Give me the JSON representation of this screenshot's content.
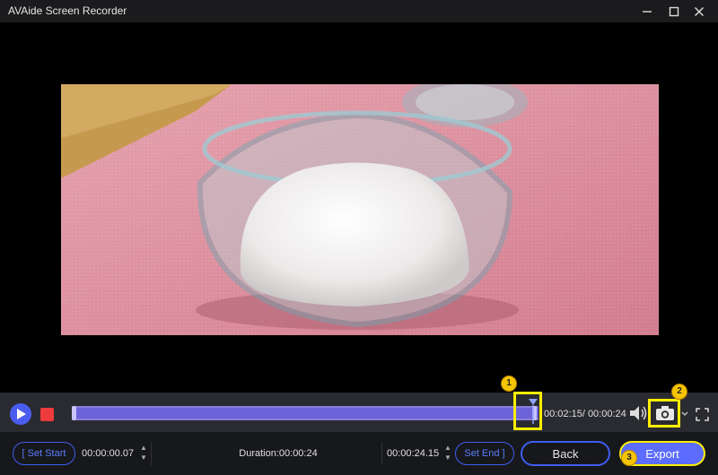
{
  "window": {
    "title": "AVAide Screen Recorder"
  },
  "playback": {
    "current_time": "00:02:15",
    "total_time": "/ 00:00:24"
  },
  "callouts": {
    "one": "1",
    "two": "2",
    "three": "3"
  },
  "trim": {
    "set_start_label": "Set Start",
    "start_time": "00:00:00.07",
    "duration_label": "Duration:00:00:24",
    "end_time": "00:00:24.15",
    "set_end_label": "Set End"
  },
  "buttons": {
    "back_label": "Back",
    "export_label": "Export"
  },
  "colors": {
    "accent": "#4a5df0",
    "highlight": "#ffef00",
    "record_red": "#ee3b3b"
  }
}
